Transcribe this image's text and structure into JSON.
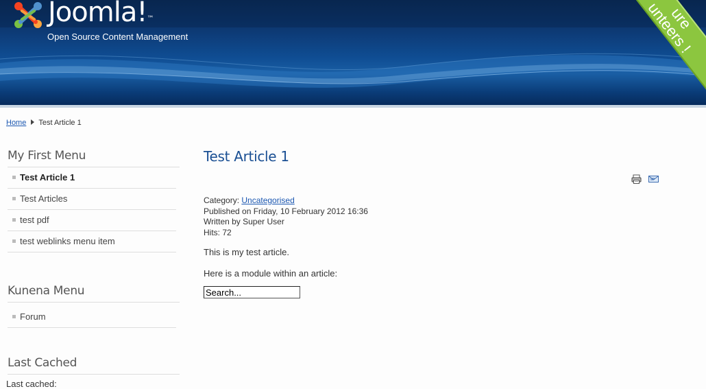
{
  "header": {
    "logo_text": "Joomla!",
    "logo_tm": "™",
    "tagline": "Open Source Content Management",
    "ribbon_text": "ure\nunteers !"
  },
  "breadcrumb": {
    "home": "Home",
    "current": "Test Article 1"
  },
  "sidebar": {
    "menu1": {
      "title": "My First Menu",
      "items": [
        {
          "label": "Test Article 1"
        },
        {
          "label": "Test Articles"
        },
        {
          "label": "test pdf"
        },
        {
          "label": "test weblinks menu item"
        }
      ]
    },
    "menu2": {
      "title": "Kunena Menu",
      "items": [
        {
          "label": "Forum"
        }
      ]
    },
    "menu3": {
      "title": "Last Cached",
      "text": "Last cached:"
    }
  },
  "article": {
    "title": "Test Article 1",
    "category_label": "Category: ",
    "category": "Uncategorised",
    "published": "Published on Friday, 10 February 2012 16:36",
    "author": "Written by Super User",
    "hits": "Hits: 72",
    "para1": "This is my test article.",
    "para2": "Here is a module within an article:",
    "search_value": "Search..."
  },
  "icons": {
    "print": "print-icon",
    "email": "email-icon"
  },
  "colors": {
    "header_dark": "#0a2a55",
    "header_mid": "#1a5fa5",
    "ribbon": "#8cc63f",
    "title": "#1a4f93",
    "link": "#1b57b1"
  }
}
